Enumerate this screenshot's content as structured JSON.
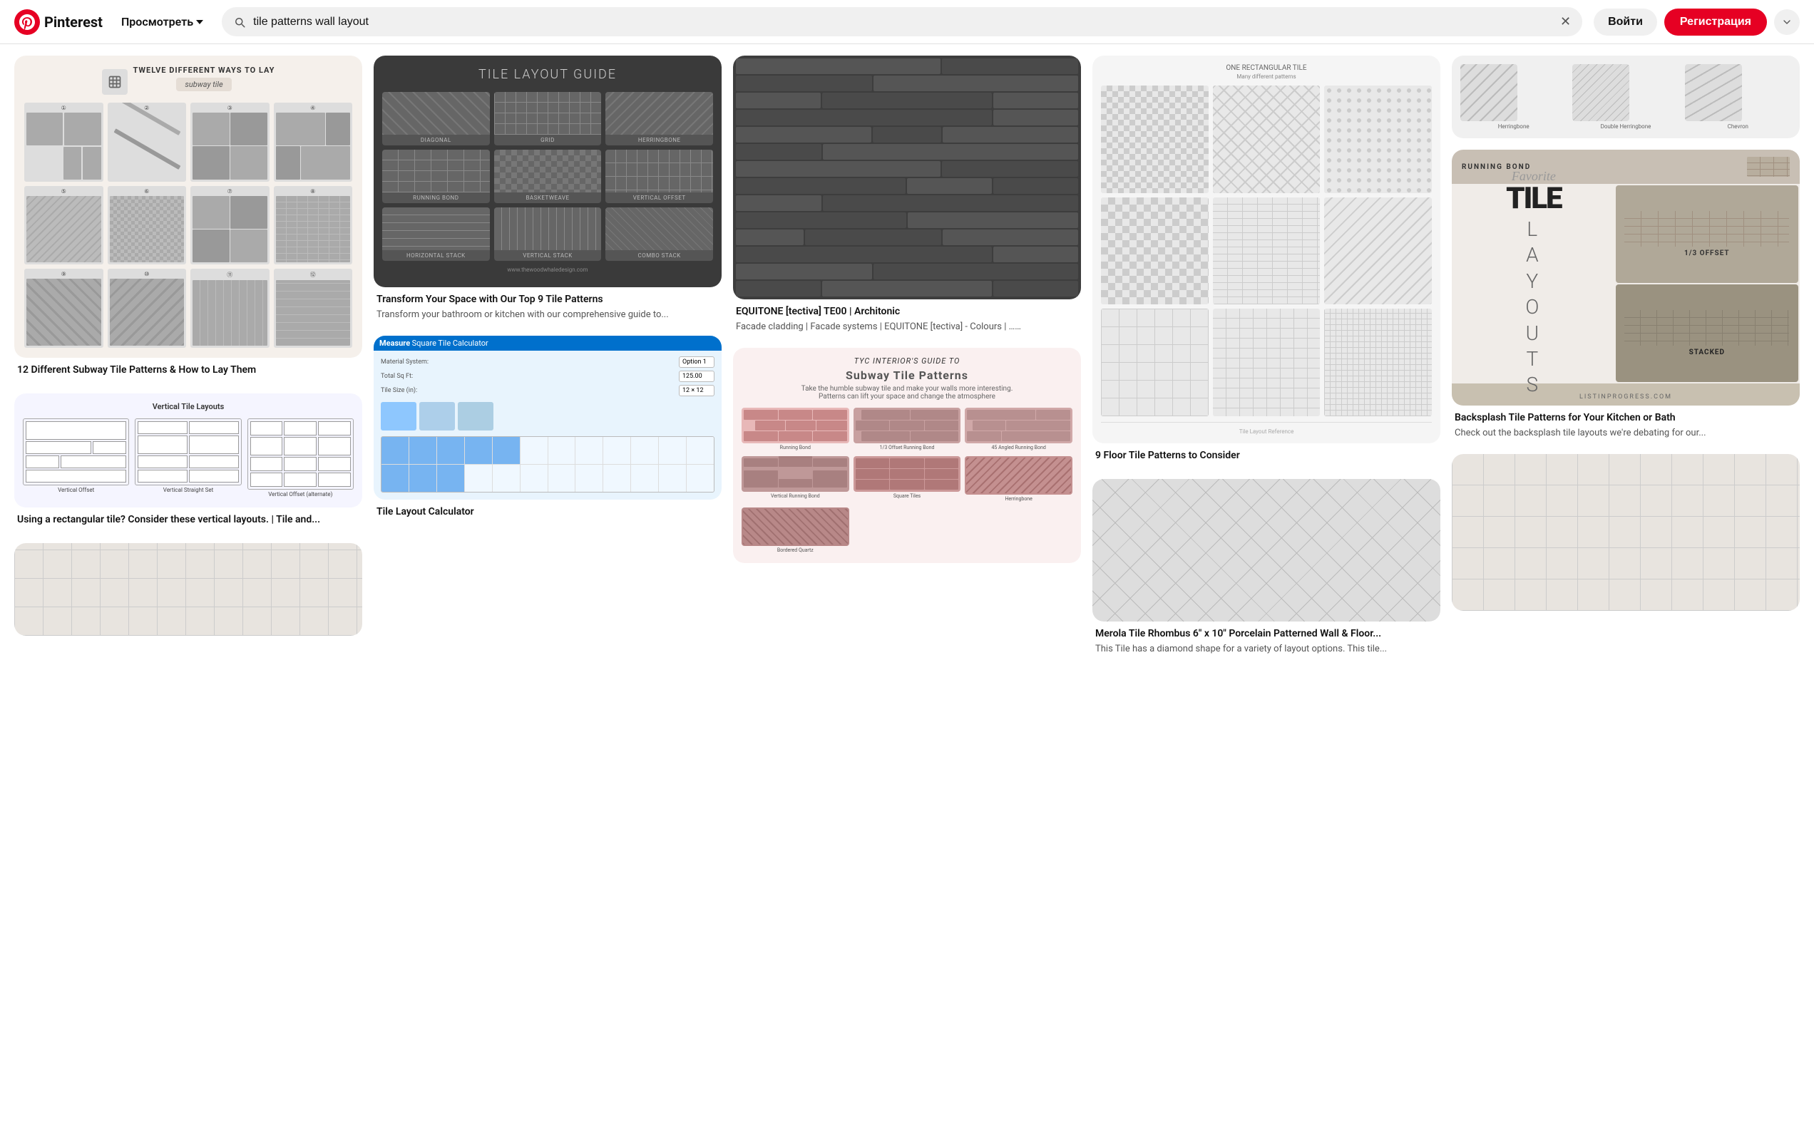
{
  "header": {
    "logo_text": "Pinterest",
    "nav_browse_label": "Просмотреть",
    "search_value": "tile patterns wall layout",
    "search_placeholder": "tile patterns wall layout",
    "btn_login_label": "Войти",
    "btn_signup_label": "Регистрация"
  },
  "pins": [
    {
      "id": "pin1",
      "title": "12 Different Subway Tile Patterns & How to Lay Them",
      "description": "",
      "image_type": "subway-ways"
    },
    {
      "id": "pin2",
      "title": "Transform Your Space with Our Top 9 Tile Patterns",
      "description": "Transform your bathroom or kitchen with our comprehensive guide to...",
      "image_type": "tile-layout-guide"
    },
    {
      "id": "pin3",
      "title": "EQUITONE [tectiva] TE00 | Architonic",
      "description": "Facade cladding | Facade systems | EQUITONE [tectiva] - Colours | ……",
      "image_type": "dark-cladding"
    },
    {
      "id": "pin4",
      "title": "9 Floor Tile Patterns to Consider",
      "description": "",
      "image_type": "floor-patterns"
    },
    {
      "id": "pin5",
      "title": "Backsplash Tile Patterns for Your Kitchen or Bath",
      "description": "Check out the backsplash tile layouts we're debating for our...",
      "image_type": "backsplash"
    },
    {
      "id": "pin6",
      "title": "Using a rectangular tile? Consider these vertical layouts. | Tile and...",
      "description": "",
      "image_type": "vertical-layouts"
    },
    {
      "id": "pin7",
      "title": "Tile Layout Calculator",
      "description": "",
      "image_type": "calculator"
    },
    {
      "id": "pin8",
      "title": "",
      "description": "",
      "image_type": "subway-patterns"
    },
    {
      "id": "pin9",
      "title": "Merola Tile Rhombus 6\" x 10\" Porcelain Patterned Wall & Floor...",
      "description": "This Tile has a diamond shape for a variety of layout options. This tile...",
      "image_type": "rhombus"
    },
    {
      "id": "pin10",
      "title": "",
      "description": "",
      "image_type": "plain-tile"
    },
    {
      "id": "pin11",
      "title": "",
      "description": "",
      "image_type": "bottom-tile1"
    },
    {
      "id": "pin12",
      "title": "",
      "description": "",
      "image_type": "herringbone"
    }
  ],
  "guide_labels": {
    "title": "TILE LAYOUT GUIDE",
    "diagonal": "DIAGONAL",
    "grid": "GRID",
    "herringbone": "HERRINGBONE",
    "running_bond": "RUNNING BOND",
    "basketweave": "BASKETWEAVE",
    "vertical_offset": "VERTICAL OFFSET",
    "horizontal_stack": "HORIZONTAL STACK",
    "vertical_stack": "VERTICAL STACK",
    "combo_stack": "COMBO STACK"
  },
  "subway_card": {
    "title": "TWELVE DIFFERENT WAYS TO LAY",
    "subtitle": "subway tile"
  },
  "vertical_card": {
    "title": "Vertical Tile Layouts",
    "label1": "Vertical Offset",
    "label2": "Vertical Straight Set",
    "label3": "Vertical Offset (alternate)"
  },
  "backsplash_card": {
    "fav": "Favorite",
    "tile": "TILE",
    "layouts_letters": [
      "L",
      "A",
      "Y",
      "O",
      "U",
      "T",
      "S"
    ],
    "running": "RUNNING BOND",
    "offset": "1/3 OFFSET",
    "stacked": "STACKED",
    "website": "LISTINPROGRESS.COM"
  },
  "rhombus_card": {
    "title": "Merola Tile Rhombus 6\" x 10\" Porcelain Patterned Wall & Floor...",
    "labels": [
      "Herringbone",
      "Double Herringbone",
      "Chevron"
    ]
  }
}
